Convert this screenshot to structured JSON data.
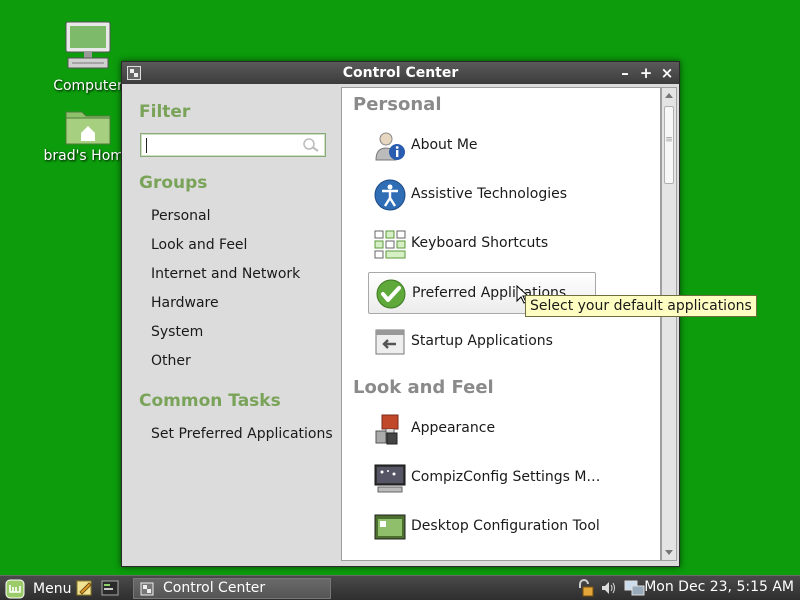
{
  "desktop": {
    "icons": [
      {
        "label": "Computer",
        "icon": "computer-icon"
      },
      {
        "label": "brad's Home",
        "icon": "home-folder-icon"
      }
    ]
  },
  "window": {
    "title": "Control Center",
    "buttons": {
      "minimize": "–",
      "maximize": "+",
      "close": "×"
    }
  },
  "sidebar": {
    "filter_heading": "Filter",
    "search_value": "",
    "groups_heading": "Groups",
    "groups": [
      "Personal",
      "Look and Feel",
      "Internet and Network",
      "Hardware",
      "System",
      "Other"
    ],
    "tasks_heading": "Common Tasks",
    "tasks": [
      "Set Preferred Applications"
    ]
  },
  "main": {
    "sections": [
      {
        "title": "Personal",
        "items": [
          {
            "label": "About Me",
            "icon": "about-me-icon"
          },
          {
            "label": "Assistive Technologies",
            "icon": "accessibility-icon"
          },
          {
            "label": "Keyboard Shortcuts",
            "icon": "keyboard-shortcuts-icon"
          },
          {
            "label": "Preferred Applications",
            "icon": "check-icon",
            "selected": true
          },
          {
            "label": "Startup Applications",
            "icon": "startup-icon"
          }
        ]
      },
      {
        "title": "Look and Feel",
        "items": [
          {
            "label": "Appearance",
            "icon": "appearance-icon"
          },
          {
            "label": "CompizConfig Settings M…",
            "icon": "compiz-icon"
          },
          {
            "label": "Desktop Configuration Tool",
            "icon": "desktop-config-icon"
          }
        ]
      }
    ]
  },
  "tooltip": {
    "text": "Select your default applications"
  },
  "taskbar": {
    "menu_label": "Menu",
    "window_button": "Control Center",
    "clock": "Mon Dec 23,  5:15 AM"
  },
  "colors": {
    "desktop_bg": "#0c9c0c",
    "heading_green": "#7aa35a",
    "category_gray": "#8a8a8a",
    "tooltip_bg": "#fefdc2"
  }
}
